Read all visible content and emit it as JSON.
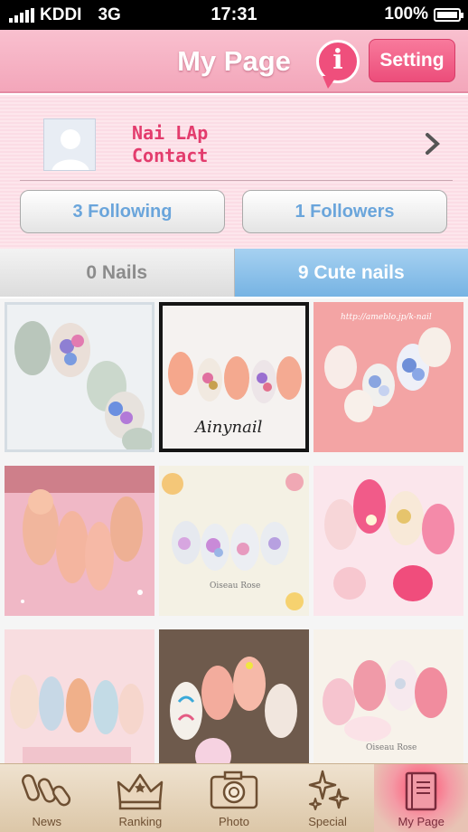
{
  "status_bar": {
    "carrier": "KDDI",
    "network": "3G",
    "time": "17:31",
    "battery": "100%"
  },
  "nav": {
    "title": "My Page",
    "info_icon": "info-bubble-icon",
    "setting_label": "Setting"
  },
  "profile": {
    "name_line1": "Nai LAp",
    "name_line2": "Contact",
    "following_label": "3 Following",
    "followers_label": "1 Followers"
  },
  "tabs": {
    "left": "0 Nails",
    "right": "9 Cute nails",
    "selected": "right"
  },
  "gallery": {
    "items": [
      {
        "caption": ""
      },
      {
        "caption": "Ainynail"
      },
      {
        "caption": "http://ameblo.jp/k-nail"
      },
      {
        "caption": ""
      },
      {
        "caption": "Oiseau Rose"
      },
      {
        "caption": ""
      },
      {
        "caption": ""
      },
      {
        "caption": ""
      },
      {
        "caption": "Oiseau Rose"
      }
    ]
  },
  "tab_bar": {
    "items": [
      {
        "label": "News",
        "icon": "nails-icon"
      },
      {
        "label": "Ranking",
        "icon": "crown-icon"
      },
      {
        "label": "Photo",
        "icon": "camera-icon"
      },
      {
        "label": "Special",
        "icon": "sparkle-icon"
      },
      {
        "label": "My Page",
        "icon": "book-icon"
      }
    ],
    "active": "My Page"
  },
  "colors": {
    "accent_pink": "#ec4d7a",
    "link_blue": "#6aa5db",
    "tab_blue": "#76b3e3"
  }
}
